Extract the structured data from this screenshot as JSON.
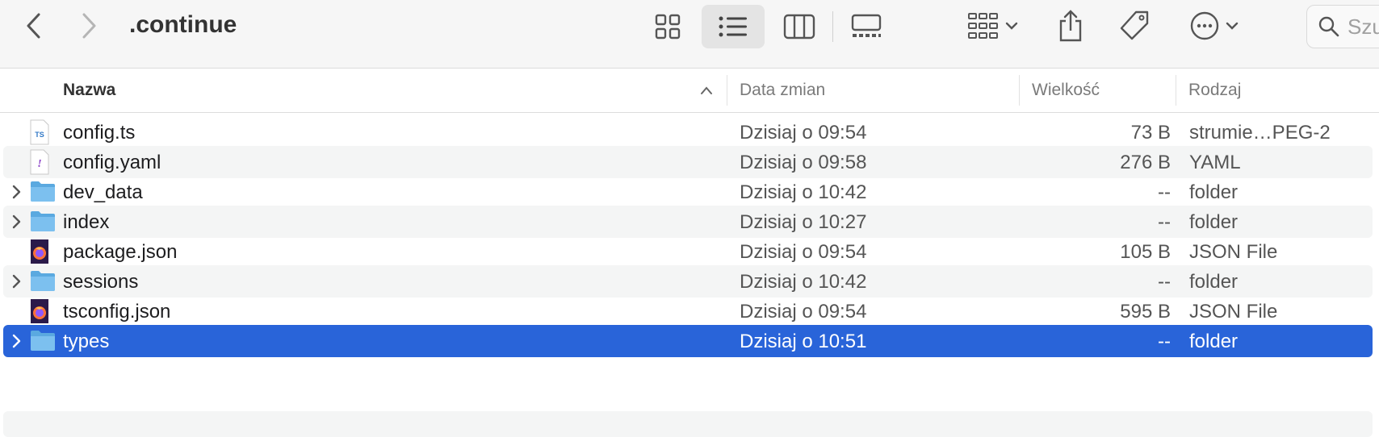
{
  "window": {
    "title": ".continue"
  },
  "search": {
    "placeholder": "Szu"
  },
  "columns": {
    "name": "Nazwa",
    "date": "Data zmian",
    "size": "Wielkość",
    "kind": "Rodzaj"
  },
  "files": [
    {
      "name": "config.ts",
      "date": "Dzisiaj o 09:54",
      "size": "73 B",
      "kind": "strumie…PEG-2",
      "icon": "ts-file-icon",
      "expandable": false
    },
    {
      "name": "config.yaml",
      "date": "Dzisiaj o 09:58",
      "size": "276 B",
      "kind": "YAML",
      "icon": "yaml-file-icon",
      "expandable": false
    },
    {
      "name": "dev_data",
      "date": "Dzisiaj o 10:42",
      "size": "--",
      "kind": "folder",
      "icon": "folder-icon",
      "expandable": true
    },
    {
      "name": "index",
      "date": "Dzisiaj o 10:27",
      "size": "--",
      "kind": "folder",
      "icon": "folder-icon",
      "expandable": true
    },
    {
      "name": "package.json",
      "date": "Dzisiaj o 09:54",
      "size": "105 B",
      "kind": "JSON File",
      "icon": "firefox-json-file-icon",
      "expandable": false
    },
    {
      "name": "sessions",
      "date": "Dzisiaj o 10:42",
      "size": "--",
      "kind": "folder",
      "icon": "folder-icon",
      "expandable": true
    },
    {
      "name": "tsconfig.json",
      "date": "Dzisiaj o 09:54",
      "size": "595 B",
      "kind": "JSON File",
      "icon": "firefox-json-file-icon",
      "expandable": false
    },
    {
      "name": "types",
      "date": "Dzisiaj o 10:51",
      "size": "--",
      "kind": "folder",
      "icon": "folder-icon",
      "expandable": true,
      "selected": true
    }
  ],
  "colors": {
    "selection": "#2964d9",
    "folder": "#6cb8ea",
    "alt_row": "#f4f5f5"
  }
}
